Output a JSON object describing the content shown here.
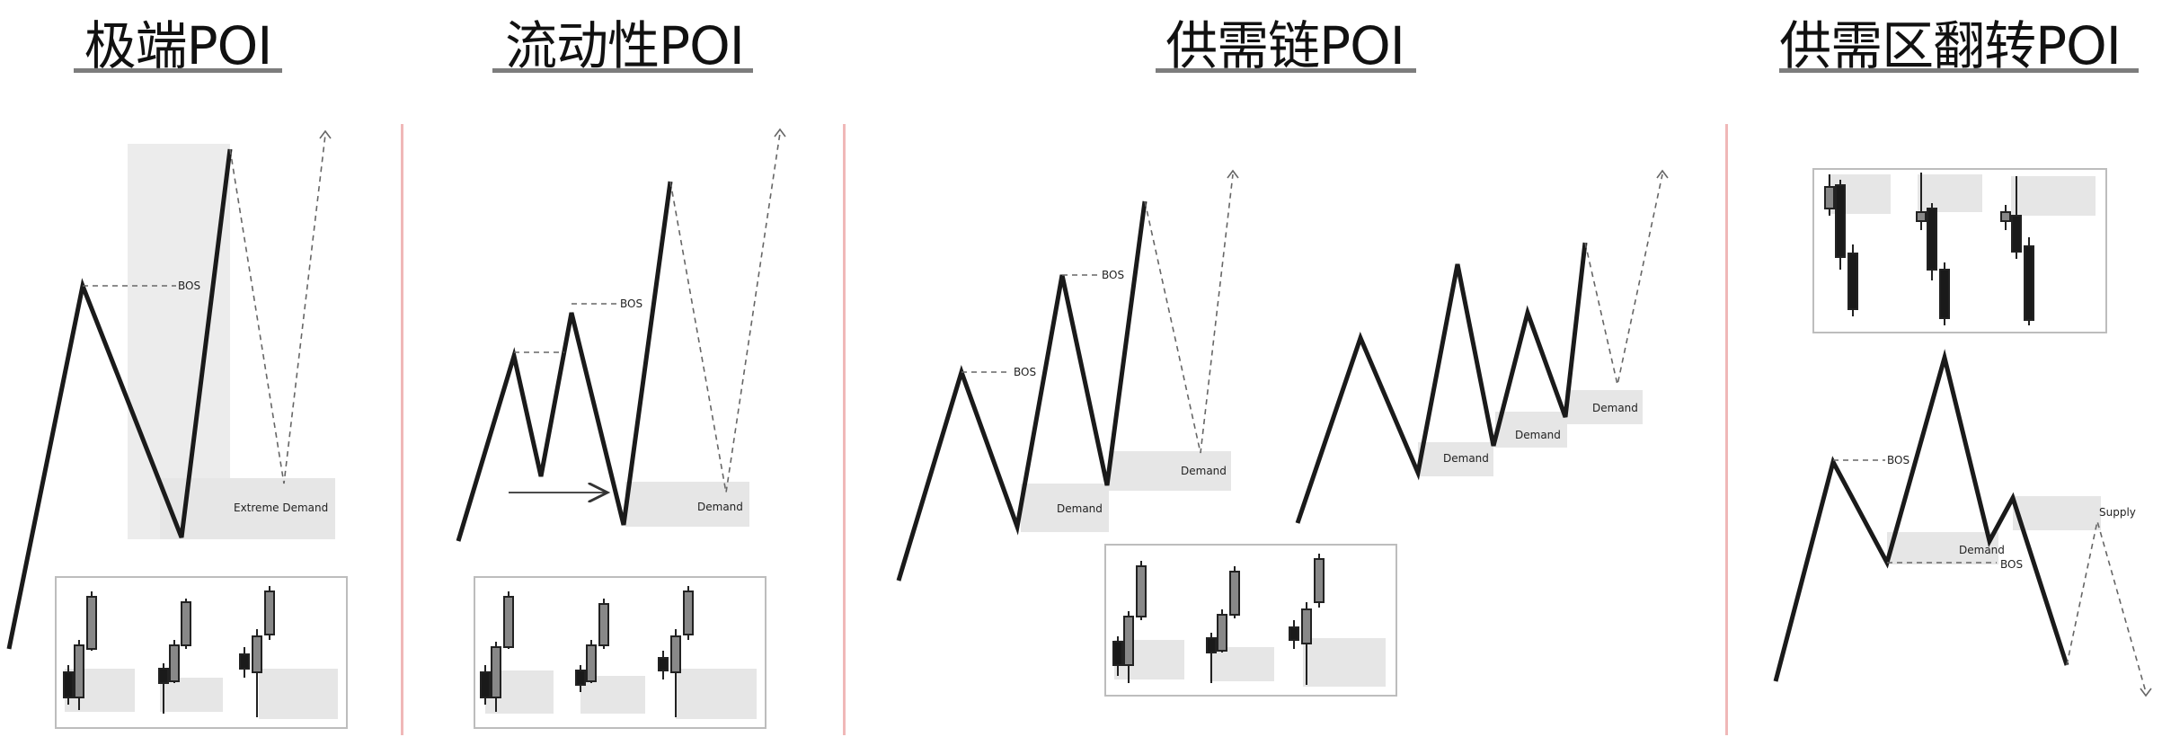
{
  "titles": {
    "p1": "极端POI",
    "p2": "流动性POI",
    "p3": "供需链POI",
    "p4": "供需区翻转POI"
  },
  "labels": {
    "bos": "BOS",
    "extreme_demand": "Extreme Demand",
    "demand": "Demand",
    "supply": "Supply"
  },
  "colors": {
    "line": "#1a1a1a",
    "dashed": "#666666",
    "zone": "#e9e9e9",
    "divider": "#f0b8b8",
    "underline": "#7d7d7d"
  }
}
